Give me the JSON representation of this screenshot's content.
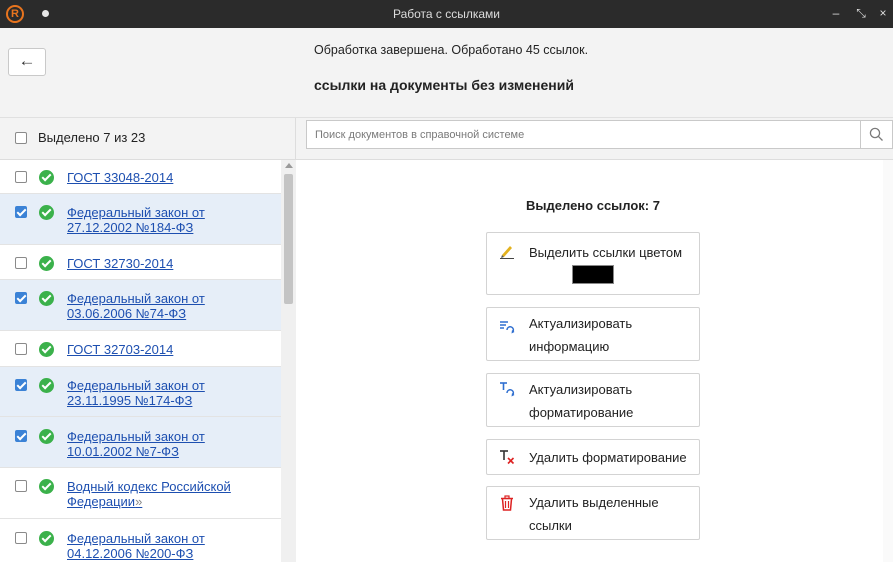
{
  "window": {
    "title": "Работа с ссылками",
    "logo_letter": "R",
    "minimize": "–",
    "restore": "⤡",
    "close": "×"
  },
  "header": {
    "back_glyph": "←",
    "status": "Обработка завершена. Обработано 45 ссылок.",
    "section_title": "ссылки на документы без изменений"
  },
  "left": {
    "selected_label": "Выделено 7 из 23",
    "items": [
      {
        "text": "ГОСТ 33048-2014",
        "checked": false
      },
      {
        "text": "Федеральный закон от 27.12.2002 №184-ФЗ",
        "checked": true
      },
      {
        "text": "ГОСТ 32730-2014",
        "checked": false
      },
      {
        "text": "Федеральный закон от 03.06.2006 №74-ФЗ",
        "checked": true
      },
      {
        "text": "ГОСТ 32703-2014",
        "checked": false
      },
      {
        "text": "Федеральный закон от 23.11.1995 №174-ФЗ",
        "checked": true
      },
      {
        "text": "Федеральный закон от 10.01.2002 №7-ФЗ",
        "checked": true
      },
      {
        "text": "Водный кодекс Российской Федерации",
        "suffix": "»",
        "checked": false
      },
      {
        "text": "Федеральный закон от 04.12.2006 №200-ФЗ",
        "checked": false
      }
    ]
  },
  "search": {
    "placeholder": "Поиск документов в справочной системе",
    "icon": "search-icon"
  },
  "actions": {
    "count_label": "Выделено ссылок: 7",
    "highlight_label": "Выделить ссылки цветом",
    "highlight_color": "#000000",
    "update_info_label": "Актуализировать информацию",
    "update_format_label": "Актуализировать форматирование",
    "remove_format_label": "Удалить форматирование",
    "delete_links_label": "Удалить выделенные ссылки"
  }
}
